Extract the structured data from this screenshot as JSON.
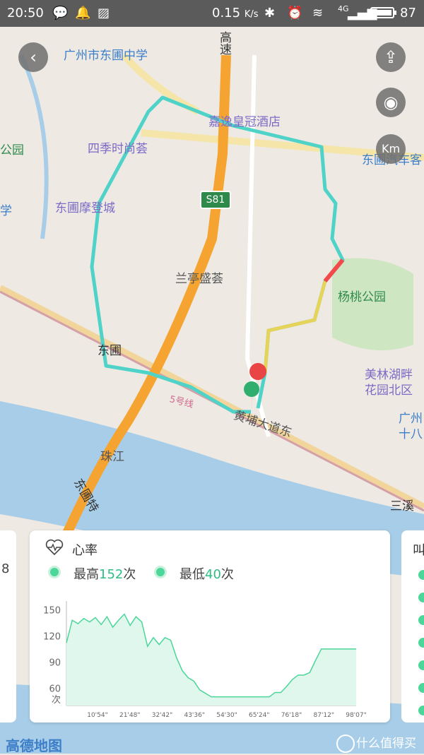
{
  "status_bar": {
    "time": "20:50",
    "network_speed": "0.15",
    "network_unit": "K/s",
    "signal": "4G",
    "battery": "87"
  },
  "map": {
    "poi": {
      "school": "广州市东圃中学",
      "highway_vertical": "高速",
      "hotel": "嘉逸皇冠酒店",
      "mall1": "四季时尚荟",
      "mall2": "东圃摩登城",
      "park_left": "公园",
      "school_left": "学",
      "bus_station": "东圃汽车客",
      "highway_badge": "S81",
      "community": "兰亭盛荟",
      "park": "杨桃公园",
      "metro_dongpu": "东圃",
      "metro_line": "5号线",
      "road_main": "黄埔大道东",
      "residential": "美林湖畔",
      "residential2": "花园北区",
      "river": "珠江",
      "guangzhou_label": "广州",
      "guangzhou_label2": "十八",
      "special_road": "东圃特",
      "sanxi": "三溪"
    }
  },
  "heart_panel": {
    "title": "心率",
    "max_label": "最高",
    "max_value": "152",
    "max_unit": "次",
    "min_label": "最低",
    "min_value": "40",
    "min_unit": "次",
    "left_card_text": "8",
    "right_card_text": "叫"
  },
  "chart_data": {
    "type": "area",
    "ylabel": "次",
    "yticks": [
      150,
      120,
      90,
      60
    ],
    "xticks": [
      "10'54\"",
      "21'48\"",
      "32'42\"",
      "43'36\"",
      "54'30\"",
      "65'24\"",
      "76'18\"",
      "87'12\"",
      "98'07\""
    ],
    "x_minutes": [
      0,
      2,
      4,
      6,
      8,
      10,
      12,
      14,
      16,
      18,
      20,
      22,
      24,
      26,
      28,
      30,
      32,
      34,
      36,
      38,
      40,
      42,
      44,
      46,
      50,
      54,
      58,
      62,
      66,
      70,
      72,
      74,
      76,
      78,
      80,
      82,
      84,
      86,
      88,
      90,
      92,
      94,
      96,
      98,
      100
    ],
    "values": [
      112,
      138,
      134,
      140,
      136,
      141,
      133,
      142,
      130,
      138,
      145,
      132,
      142,
      136,
      108,
      118,
      110,
      118,
      115,
      95,
      80,
      72,
      68,
      58,
      50,
      50,
      50,
      50,
      50,
      50,
      55,
      55,
      62,
      70,
      75,
      75,
      78,
      92,
      105,
      105,
      105,
      105,
      105,
      105,
      105
    ],
    "ylim": [
      40,
      160
    ],
    "color": "#4cd69a"
  },
  "footer": {
    "logo": "高德地图",
    "watermark": "什么值得买"
  }
}
